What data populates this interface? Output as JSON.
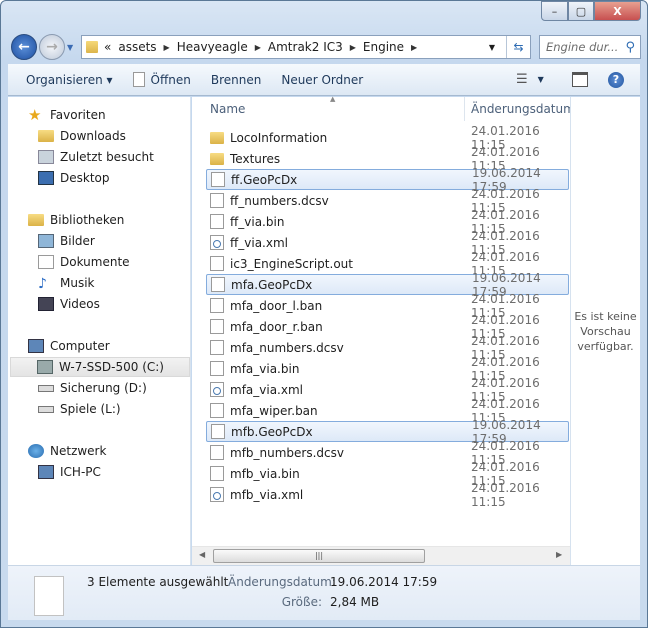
{
  "window": {
    "min": "▭",
    "max": "▢",
    "close": "X"
  },
  "address": {
    "crumbs": [
      "«",
      "assets",
      "Heavyeagle",
      "Amtrak2 IC3",
      "Engine"
    ],
    "search_placeholder": "Engine dur..."
  },
  "toolbar": {
    "organize": "Organisieren ▾",
    "open": "Öffnen",
    "burn": "Brennen",
    "new_folder": "Neuer Ordner",
    "help": "?"
  },
  "nav": {
    "favorites": {
      "label": "Favoriten",
      "items": [
        "Downloads",
        "Zuletzt besucht",
        "Desktop"
      ]
    },
    "libraries": {
      "label": "Bibliotheken",
      "items": [
        "Bilder",
        "Dokumente",
        "Musik",
        "Videos"
      ]
    },
    "computer": {
      "label": "Computer",
      "items": [
        "W-7-SSD-500 (C:)",
        "Sicherung (D:)",
        "Spiele (L:)"
      ]
    },
    "network": {
      "label": "Netzwerk",
      "items": [
        "ICH-PC"
      ]
    }
  },
  "columns": {
    "name": "Name",
    "date": "Änderungsdatum"
  },
  "files": [
    {
      "name": "LocoInformation",
      "date": "24.01.2016 11:15",
      "type": "folder",
      "selected": false
    },
    {
      "name": "Textures",
      "date": "24.01.2016 11:15",
      "type": "folder",
      "selected": false
    },
    {
      "name": "ff.GeoPcDx",
      "date": "19.06.2014 17:59",
      "type": "file",
      "selected": true
    },
    {
      "name": "ff_numbers.dcsv",
      "date": "24.01.2016 11:15",
      "type": "file",
      "selected": false
    },
    {
      "name": "ff_via.bin",
      "date": "24.01.2016 11:15",
      "type": "file",
      "selected": false
    },
    {
      "name": "ff_via.xml",
      "date": "24.01.2016 11:15",
      "type": "xml",
      "selected": false
    },
    {
      "name": "ic3_EngineScript.out",
      "date": "24.01.2016 11:15",
      "type": "file",
      "selected": false
    },
    {
      "name": "mfa.GeoPcDx",
      "date": "19.06.2014 17:59",
      "type": "file",
      "selected": true
    },
    {
      "name": "mfa_door_l.ban",
      "date": "24.01.2016 11:15",
      "type": "file",
      "selected": false
    },
    {
      "name": "mfa_door_r.ban",
      "date": "24.01.2016 11:15",
      "type": "file",
      "selected": false
    },
    {
      "name": "mfa_numbers.dcsv",
      "date": "24.01.2016 11:15",
      "type": "file",
      "selected": false
    },
    {
      "name": "mfa_via.bin",
      "date": "24.01.2016 11:15",
      "type": "file",
      "selected": false
    },
    {
      "name": "mfa_via.xml",
      "date": "24.01.2016 11:15",
      "type": "xml",
      "selected": false
    },
    {
      "name": "mfa_wiper.ban",
      "date": "24.01.2016 11:15",
      "type": "file",
      "selected": false
    },
    {
      "name": "mfb.GeoPcDx",
      "date": "19.06.2014 17:59",
      "type": "file",
      "selected": true
    },
    {
      "name": "mfb_numbers.dcsv",
      "date": "24.01.2016 11:15",
      "type": "file",
      "selected": false
    },
    {
      "name": "mfb_via.bin",
      "date": "24.01.2016 11:15",
      "type": "file",
      "selected": false
    },
    {
      "name": "mfb_via.xml",
      "date": "24.01.2016 11:15",
      "type": "xml",
      "selected": false
    }
  ],
  "preview": {
    "text": "Es ist keine Vorschau verfügbar."
  },
  "status": {
    "selection": "3 Elemente ausgewählt",
    "date_label": "Änderungsdatum:",
    "date": "19.06.2014 17:59",
    "size_label": "Größe:",
    "size": "2,84 MB"
  }
}
